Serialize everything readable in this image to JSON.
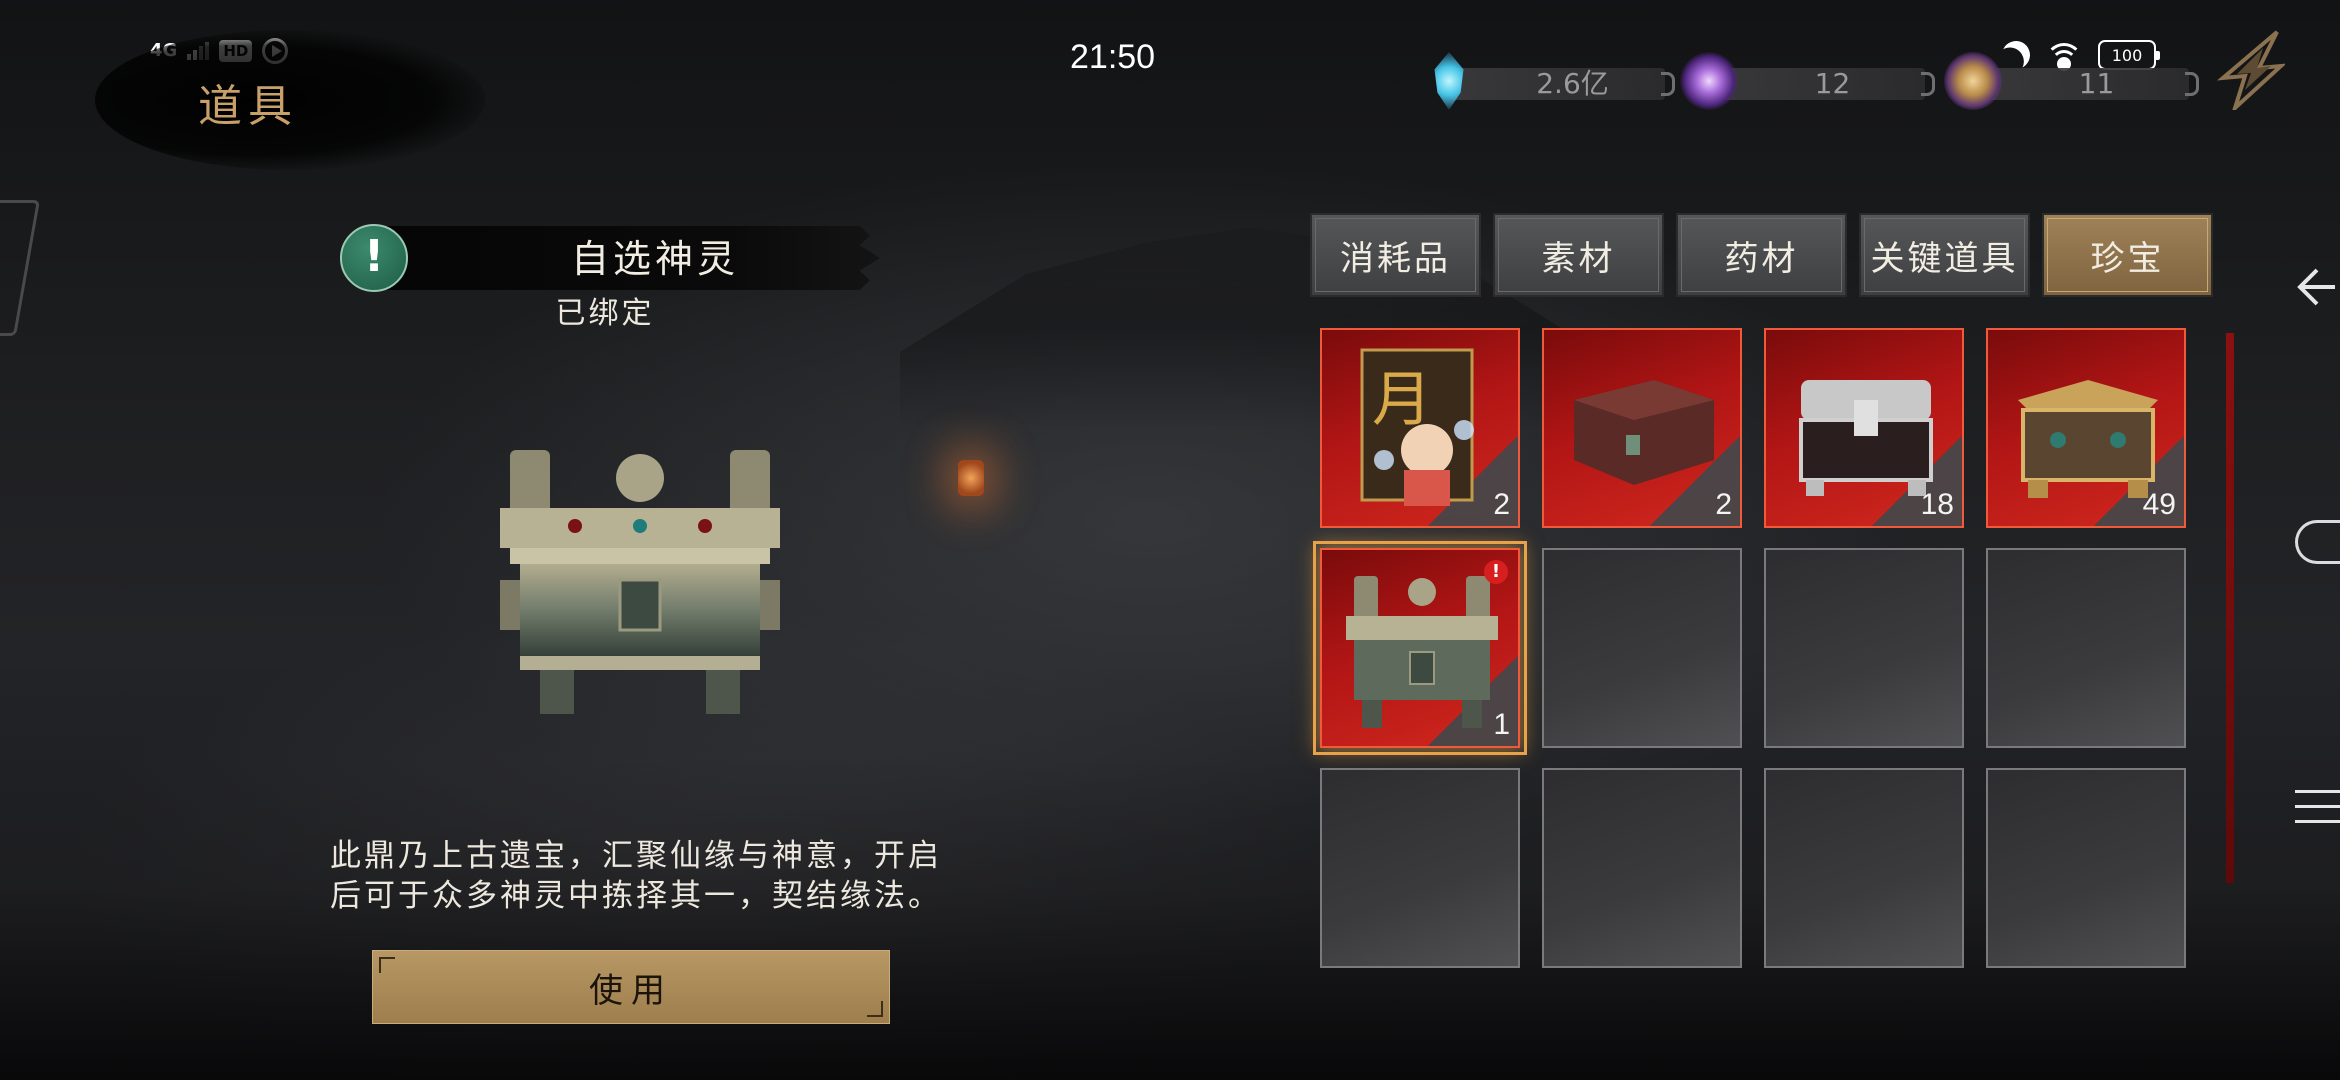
{
  "status_bar": {
    "network": "4G",
    "hd": "HD",
    "time": "21:50",
    "battery": "100"
  },
  "page": {
    "title": "道具"
  },
  "currencies": [
    {
      "icon": "crystal-icon",
      "value": "2.6亿"
    },
    {
      "icon": "purple-orb-icon",
      "value": "12"
    },
    {
      "icon": "gold-orb-icon",
      "value": "11"
    }
  ],
  "item": {
    "name": "自选神灵",
    "bound": "已绑定",
    "description_line1": "此鼎乃上古遗宝，汇聚仙缘与神意，开启",
    "description_line2": "后可于众多神灵中拣择其一，契结缘法。",
    "use_label": "使用"
  },
  "tabs": [
    {
      "label": "消耗品",
      "active": false
    },
    {
      "label": "素材",
      "active": false
    },
    {
      "label": "药材",
      "active": false
    },
    {
      "label": "关键道具",
      "active": false
    },
    {
      "label": "珍宝",
      "active": true
    }
  ],
  "inventory": [
    {
      "art": "character-card-icon",
      "count": "2"
    },
    {
      "art": "lacquer-box-icon",
      "count": "2"
    },
    {
      "art": "silver-chest-icon",
      "count": "18"
    },
    {
      "art": "gold-chest-icon",
      "count": "49"
    },
    {
      "art": "bronze-cauldron-icon",
      "count": "1",
      "new_badge": "!"
    }
  ],
  "colors": {
    "accent_gold": "#9f8258",
    "rare_red": "#b11515",
    "selected_glow": "#e8a24a"
  }
}
